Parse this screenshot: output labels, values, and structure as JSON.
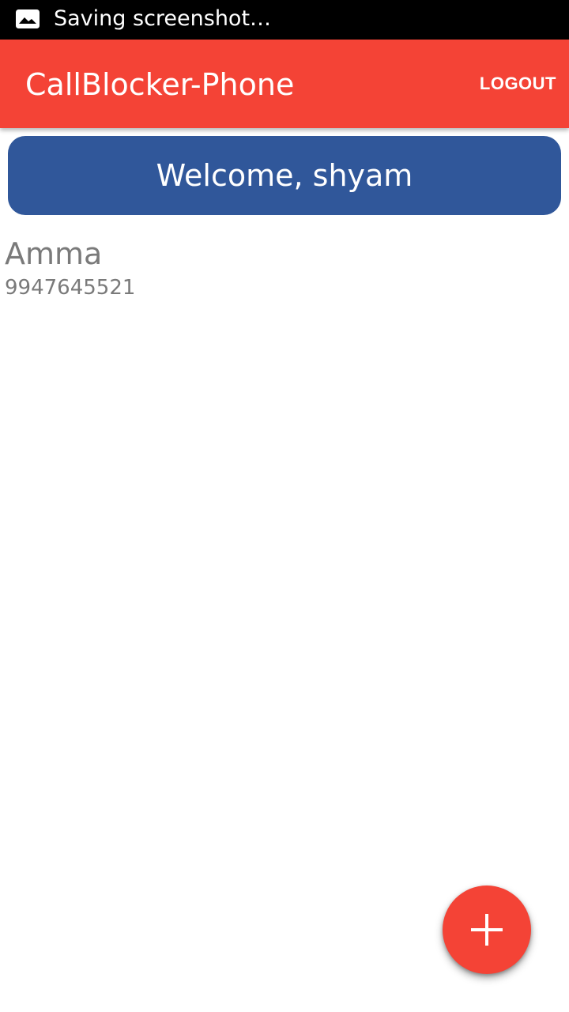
{
  "status_bar": {
    "notification_icon": "image-icon",
    "text": "Saving screenshot…"
  },
  "app_bar": {
    "title": "CallBlocker-Phone",
    "logout_label": "LOGOUT",
    "color": "#f44336"
  },
  "welcome": {
    "text": "Welcome, shyam",
    "color": "#30579a"
  },
  "contacts": [
    {
      "name": "Amma",
      "number": "9947645521"
    }
  ],
  "fab": {
    "icon": "plus-icon",
    "color": "#f44336"
  }
}
